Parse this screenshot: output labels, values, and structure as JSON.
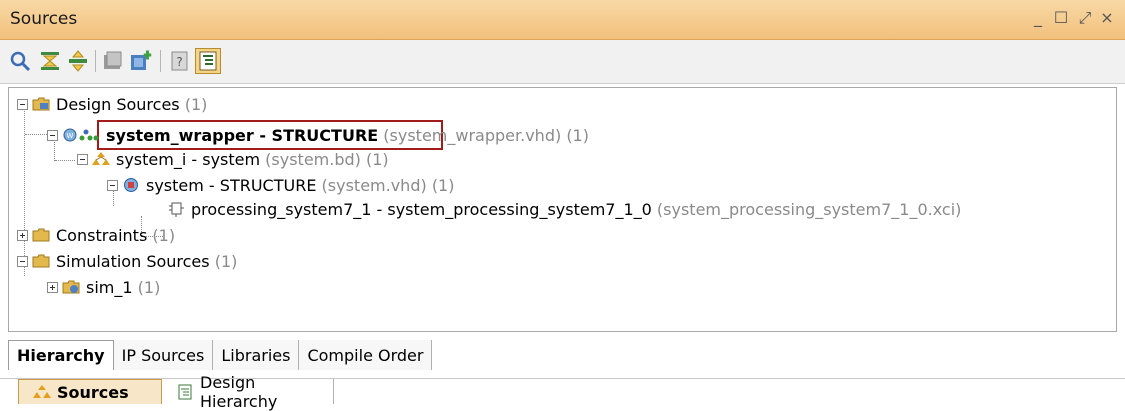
{
  "window": {
    "title": "Sources",
    "controls": [
      "minimize-icon",
      "maximize-icon",
      "float-icon",
      "close-icon"
    ]
  },
  "toolbar": {
    "buttons": [
      "search-icon",
      "collapse-all-icon",
      "expand-all-icon",
      "add-sources-icon",
      "add-ip-icon",
      "help-icon",
      "hierarchy-view-icon"
    ]
  },
  "tree": {
    "design_sources": {
      "label": "Design Sources",
      "count": "(1)"
    },
    "system_wrapper": {
      "label": "system_wrapper - STRUCTURE",
      "file": "(system_wrapper.vhd)",
      "count": "(1)"
    },
    "system_i": {
      "label": "system_i - system",
      "file": "(system.bd)",
      "count": "(1)"
    },
    "system": {
      "label": "system - STRUCTURE",
      "file": "(system.vhd)",
      "count": "(1)"
    },
    "processing": {
      "label": "processing_system7_1 - system_processing_system7_1_0",
      "file": "(system_processing_system7_1_0.xci)"
    },
    "constraints": {
      "label": "Constraints",
      "count": "(1)"
    },
    "simulation_sources": {
      "label": "Simulation Sources",
      "count": "(1)"
    },
    "sim_1": {
      "label": "sim_1",
      "count": "(1)"
    }
  },
  "view_tabs": [
    "Hierarchy",
    "IP Sources",
    "Libraries",
    "Compile Order"
  ],
  "panel_tabs": [
    "Sources",
    "Design Hierarchy"
  ],
  "colors": {
    "titlebar": "#f2c07c",
    "highlight_border": "#a31a1a",
    "folder": "#e3b94e"
  }
}
